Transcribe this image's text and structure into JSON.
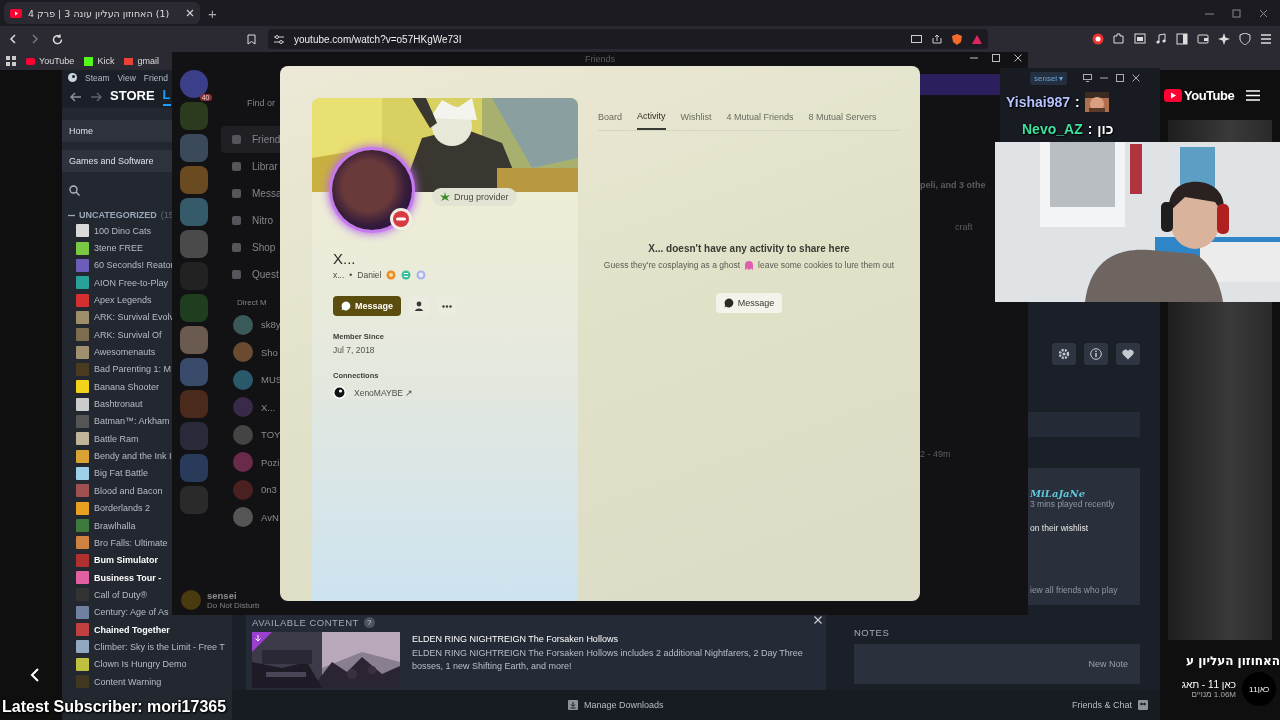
{
  "browser": {
    "tab": {
      "title": "(1) האחוזון העליון עונה 3 | פרק 4",
      "selected": true
    },
    "new_tab": "+",
    "url": "youtube.com/watch?v=o57HKgWe73I",
    "bookmarks": [
      "YouTube",
      "Kick",
      "gmail"
    ]
  },
  "steam": {
    "menu": [
      "Steam",
      "View",
      "Friend"
    ],
    "nav": [
      {
        "label": "STORE",
        "selected": false
      },
      {
        "label": "L",
        "selected": true
      }
    ],
    "sidebar": {
      "home": "Home",
      "filter": "Games and Software",
      "category": "UNCATEGORIZED",
      "count": "(15",
      "games": [
        {
          "name": "100 Dino Cats",
          "installed": false
        },
        {
          "name": "3tene FREE",
          "installed": false
        },
        {
          "name": "60 Seconds! Reator",
          "installed": false
        },
        {
          "name": "AION Free-to-Play",
          "installed": false
        },
        {
          "name": "Apex Legends",
          "installed": false
        },
        {
          "name": "ARK: Survival Evolv",
          "installed": false
        },
        {
          "name": "ARK: Survival Of",
          "installed": false
        },
        {
          "name": "Awesomenauts",
          "installed": false
        },
        {
          "name": "Bad Parenting 1: M",
          "installed": false
        },
        {
          "name": "Banana Shooter",
          "installed": false
        },
        {
          "name": "Bashtronaut",
          "installed": false
        },
        {
          "name": "Batman™: Arkham",
          "installed": false
        },
        {
          "name": "Battle Ram",
          "installed": false
        },
        {
          "name": "Bendy and the Ink I",
          "installed": false
        },
        {
          "name": "Big Fat Battle",
          "installed": false
        },
        {
          "name": "Blood and Bacon",
          "installed": false
        },
        {
          "name": "Borderlands 2",
          "installed": false
        },
        {
          "name": "Brawlhalla",
          "installed": false
        },
        {
          "name": "Bro Falls: Ultimate",
          "installed": false
        },
        {
          "name": "Bum Simulator",
          "installed": true
        },
        {
          "name": "Business Tour -",
          "installed": true
        },
        {
          "name": "Call of Duty®",
          "installed": false
        },
        {
          "name": "Century: Age of As",
          "installed": false
        },
        {
          "name": "Chained Together",
          "installed": true
        },
        {
          "name": "Climber: Sky is the Limit - Free T",
          "installed": false
        },
        {
          "name": "Clown Is Hungry Demo",
          "installed": false
        },
        {
          "name": "Content Warning",
          "installed": false
        }
      ]
    },
    "available_content": {
      "heading": "AVAILABLE CONTENT",
      "help": "?",
      "title": "ELDEN RING NIGHTREIGN The Forsaken Hollows",
      "description": "ELDEN RING NIGHTREIGN The Forsaken Hollows includes 2 additional Nightfarers, 2 Day Three bosses, 1 new Shifting Earth, and more!"
    },
    "notes": {
      "heading": "NOTES",
      "button": "New Note"
    },
    "friends_card": {
      "name": "MiLaJaNe",
      "activity": "3 mins played recently",
      "wishlist": "on their wishlist",
      "view_all": "iew all friends who play"
    },
    "downloads": "Manage Downloads",
    "friends_chat": "Friends & Chat"
  },
  "discord": {
    "title": "Friends",
    "badge": "40",
    "search": "Find or",
    "nav": [
      {
        "label": "Friend",
        "selected": true
      },
      {
        "label": "Librar",
        "selected": false
      },
      {
        "label": "Messa",
        "selected": false
      },
      {
        "label": "Nitro",
        "selected": false
      },
      {
        "label": "Shop",
        "selected": false
      },
      {
        "label": "Quest",
        "selected": false
      }
    ],
    "dm_heading": "Direct M",
    "dms": [
      "sk8y",
      "Sho",
      "MUS",
      "X...",
      "TOY",
      "Pozi",
      "0n3",
      "AvN"
    ],
    "user": {
      "name": "sensei",
      "status": "Do Not Disturb"
    },
    "activity": [
      {
        "text": "peli, and 3 othe"
      },
      {
        "text": "craft"
      },
      {
        "text": "2 - 49m"
      }
    ],
    "profile": {
      "display_name": "X...",
      "username": "x...",
      "separator": "•",
      "pronoun": "Daniel",
      "status": "Drug provider",
      "do_not_disturb": true,
      "message_button": "Message",
      "member_since_label": "Member Since",
      "member_since": "Jul 7, 2018",
      "connections_label": "Connections",
      "connection": "XenoMAYBE ↗",
      "tabs": [
        {
          "label": "Board",
          "selected": false
        },
        {
          "label": "Activity",
          "selected": true
        },
        {
          "label": "Wishlist",
          "selected": false
        },
        {
          "label": "4 Mutual Friends",
          "selected": false
        },
        {
          "label": "8 Mutual Servers",
          "selected": false
        }
      ],
      "empty_title": "X... doesn't have any activity to share here",
      "empty_text_before": "Guess they're cosplaying as a ghost",
      "empty_text_after": "leave some cookies to lure them out",
      "empty_button": "Message"
    }
  },
  "chat_overlay": {
    "user": "sensei ▾",
    "messages": [
      {
        "author": "Yishai987",
        "color": "#b7c3ff",
        "separator": ":",
        "kind": "emote"
      },
      {
        "author": "Nevo_AZ",
        "color": "#3fe0a0",
        "separator": ":",
        "kind": "text",
        "text": "כון"
      }
    ]
  },
  "youtube": {
    "logo": "YouTube",
    "video_title": "האחוזון העליון ע",
    "channel": "כאן 11 - תאג",
    "subscribers": "1.06M מנויים",
    "avatar": "כאן11"
  },
  "overlay": {
    "latest_subscriber": "Latest Subscriber: mori17365"
  }
}
